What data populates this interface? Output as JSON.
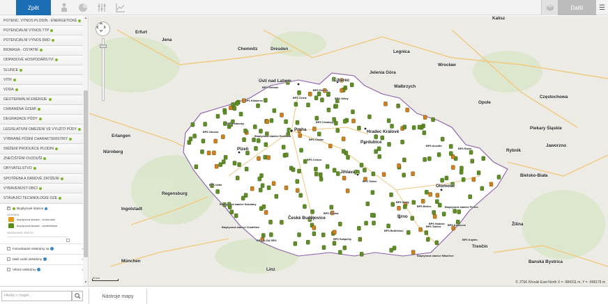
{
  "toolbar": {
    "back_label": "Zpět",
    "icons": [
      "person-map-icon",
      "pie-chart-icon",
      "sliders-icon",
      "area-chart-icon"
    ],
    "cube_icon": "cube-icon",
    "next_label": "Další",
    "menu_icon": "hamburger-icon"
  },
  "sidebar": {
    "layers": [
      {
        "label": "POTENC. VÝNOS PLODIN - ENERGETICKÉ"
      },
      {
        "label": "POTENCIÁLNÍ VÝNOS TTP"
      },
      {
        "label": "POTENCIÁLNÍ VÝNOS RRD"
      },
      {
        "label": "BIOMASA - OSTATNÍ"
      },
      {
        "label": "ODPADOVÉ HOSPODÁŘSTVÍ"
      },
      {
        "label": "SLUNCE"
      },
      {
        "label": "VÍTR"
      },
      {
        "label": "VODA"
      },
      {
        "label": "GEOTERMÁLNÍ ENERGIE"
      },
      {
        "label": "CHRÁNĚNÁ ÚZEMÍ"
      },
      {
        "label": "DEGRADACE PŮDY"
      },
      {
        "label": "LEGISLATIVNÍ OMEZENÍ VE VYUŽITÍ PŮDY"
      },
      {
        "label": "VYBRANÉ PŮDNÍ CHARAKTERISTIKY"
      },
      {
        "label": "SNÍŽENÍ PRODUKCE PLODIN"
      },
      {
        "label": "ZNEČIŠTĚNÍ OVZDUŠÍ"
      },
      {
        "label": "OBYVATELSTVO"
      },
      {
        "label": "SPOTŘEBA A DAŇOVÉ ZATÍŽENÍ"
      },
      {
        "label": "VYBAVENOST OBCÍ"
      },
      {
        "label": "STÁVAJÍCÍ TECHNOLOGIE OZE"
      }
    ],
    "expanded": {
      "layer_label": "Bioplynové stanice",
      "legend_title": "LEGENDA:",
      "legend_items": [
        {
          "label": "bioplynová stanice - komunální",
          "color": "#e89a1e"
        },
        {
          "label": "bioplynová stanice - zemědělská",
          "color": "#5b8f1e"
        }
      ],
      "visibility_label": "VIDITELNOST VRSTVY:"
    },
    "sub_layers": [
      {
        "label": "Fotovoltaické elektrárny na"
      },
      {
        "label": "Malé vodní elektrárny"
      },
      {
        "label": "Větrné elektrárny"
      }
    ]
  },
  "bottom": {
    "search_placeholder": "Hledej v mapě...",
    "tools_label": "Nástroje mapy"
  },
  "map": {
    "cities": [
      {
        "name": "Kalisz"
      },
      {
        "name": "Erfurt"
      },
      {
        "name": "Jena"
      },
      {
        "name": "Chemnitz"
      },
      {
        "name": "Dresden"
      },
      {
        "name": "Legnica"
      },
      {
        "name": "Wrocław"
      },
      {
        "name": "Jelenia Góra"
      },
      {
        "name": "Wałbrzych"
      },
      {
        "name": "Opole"
      },
      {
        "name": "Częstochowa"
      },
      {
        "name": "Ústí nad Labem"
      },
      {
        "name": "Liberec"
      },
      {
        "name": "Praha"
      },
      {
        "name": "Hradec Králové"
      },
      {
        "name": "Pardubice"
      },
      {
        "name": "Plzeň"
      },
      {
        "name": "Erlangen"
      },
      {
        "name": "Nürnberg"
      },
      {
        "name": "Regensburg"
      },
      {
        "name": "Ingolstadt"
      },
      {
        "name": "München"
      },
      {
        "name": "České Budějovice"
      },
      {
        "name": "Jihlava"
      },
      {
        "name": "Brno"
      },
      {
        "name": "Olomouc"
      },
      {
        "name": "Piekary Śląskie"
      },
      {
        "name": "Rybnik"
      },
      {
        "name": "Jaworzno"
      },
      {
        "name": "Bielsko-Biała"
      },
      {
        "name": "Žilina"
      },
      {
        "name": "Trenčín"
      },
      {
        "name": "Banská Bystrica"
      },
      {
        "name": "Linz"
      }
    ],
    "bps_labels": [
      {
        "name": "BPS Vilémov"
      },
      {
        "name": "BPS Hrčeev"
      },
      {
        "name": "BPS Klášterec"
      },
      {
        "name": "BPS Černá"
      },
      {
        "name": "BPS Jičiny"
      },
      {
        "name": "BPS Chvalepy"
      },
      {
        "name": "BPS Podmoky"
      },
      {
        "name": "BPS Otrocín"
      },
      {
        "name": "Bioplynová stanice Hostivice"
      },
      {
        "name": "BPS Čáslav"
      },
      {
        "name": "BPS Accolth"
      },
      {
        "name": "BPS Rusín"
      },
      {
        "name": "BPS Cernín"
      },
      {
        "name": "BPS Tečice"
      },
      {
        "name": "BPS Ustín"
      },
      {
        "name": "BPS Skály"
      },
      {
        "name": "BPS Brčice"
      },
      {
        "name": "Bioplynová stanice Sokolany"
      },
      {
        "name": "Bioplynová stanice Přerov"
      },
      {
        "name": "Bioplynová stanice Chodětice"
      },
      {
        "name": "BPS Tetčice"
      },
      {
        "name": "BPS Bedřichov"
      },
      {
        "name": "BPS Hrabice"
      },
      {
        "name": "BPS Kamenné"
      },
      {
        "name": "BPS Šebína"
      },
      {
        "name": "BPS ELGA SRO"
      },
      {
        "name": "BPS Kašperky"
      },
      {
        "name": "BPS Kojetín"
      },
      {
        "name": "Bioplynová stanice Mikulčice"
      }
    ],
    "scale_label": "10 km",
    "coords_text": "© JTSK Křovák East North  X = -984311 m, Y = -998179 m"
  }
}
